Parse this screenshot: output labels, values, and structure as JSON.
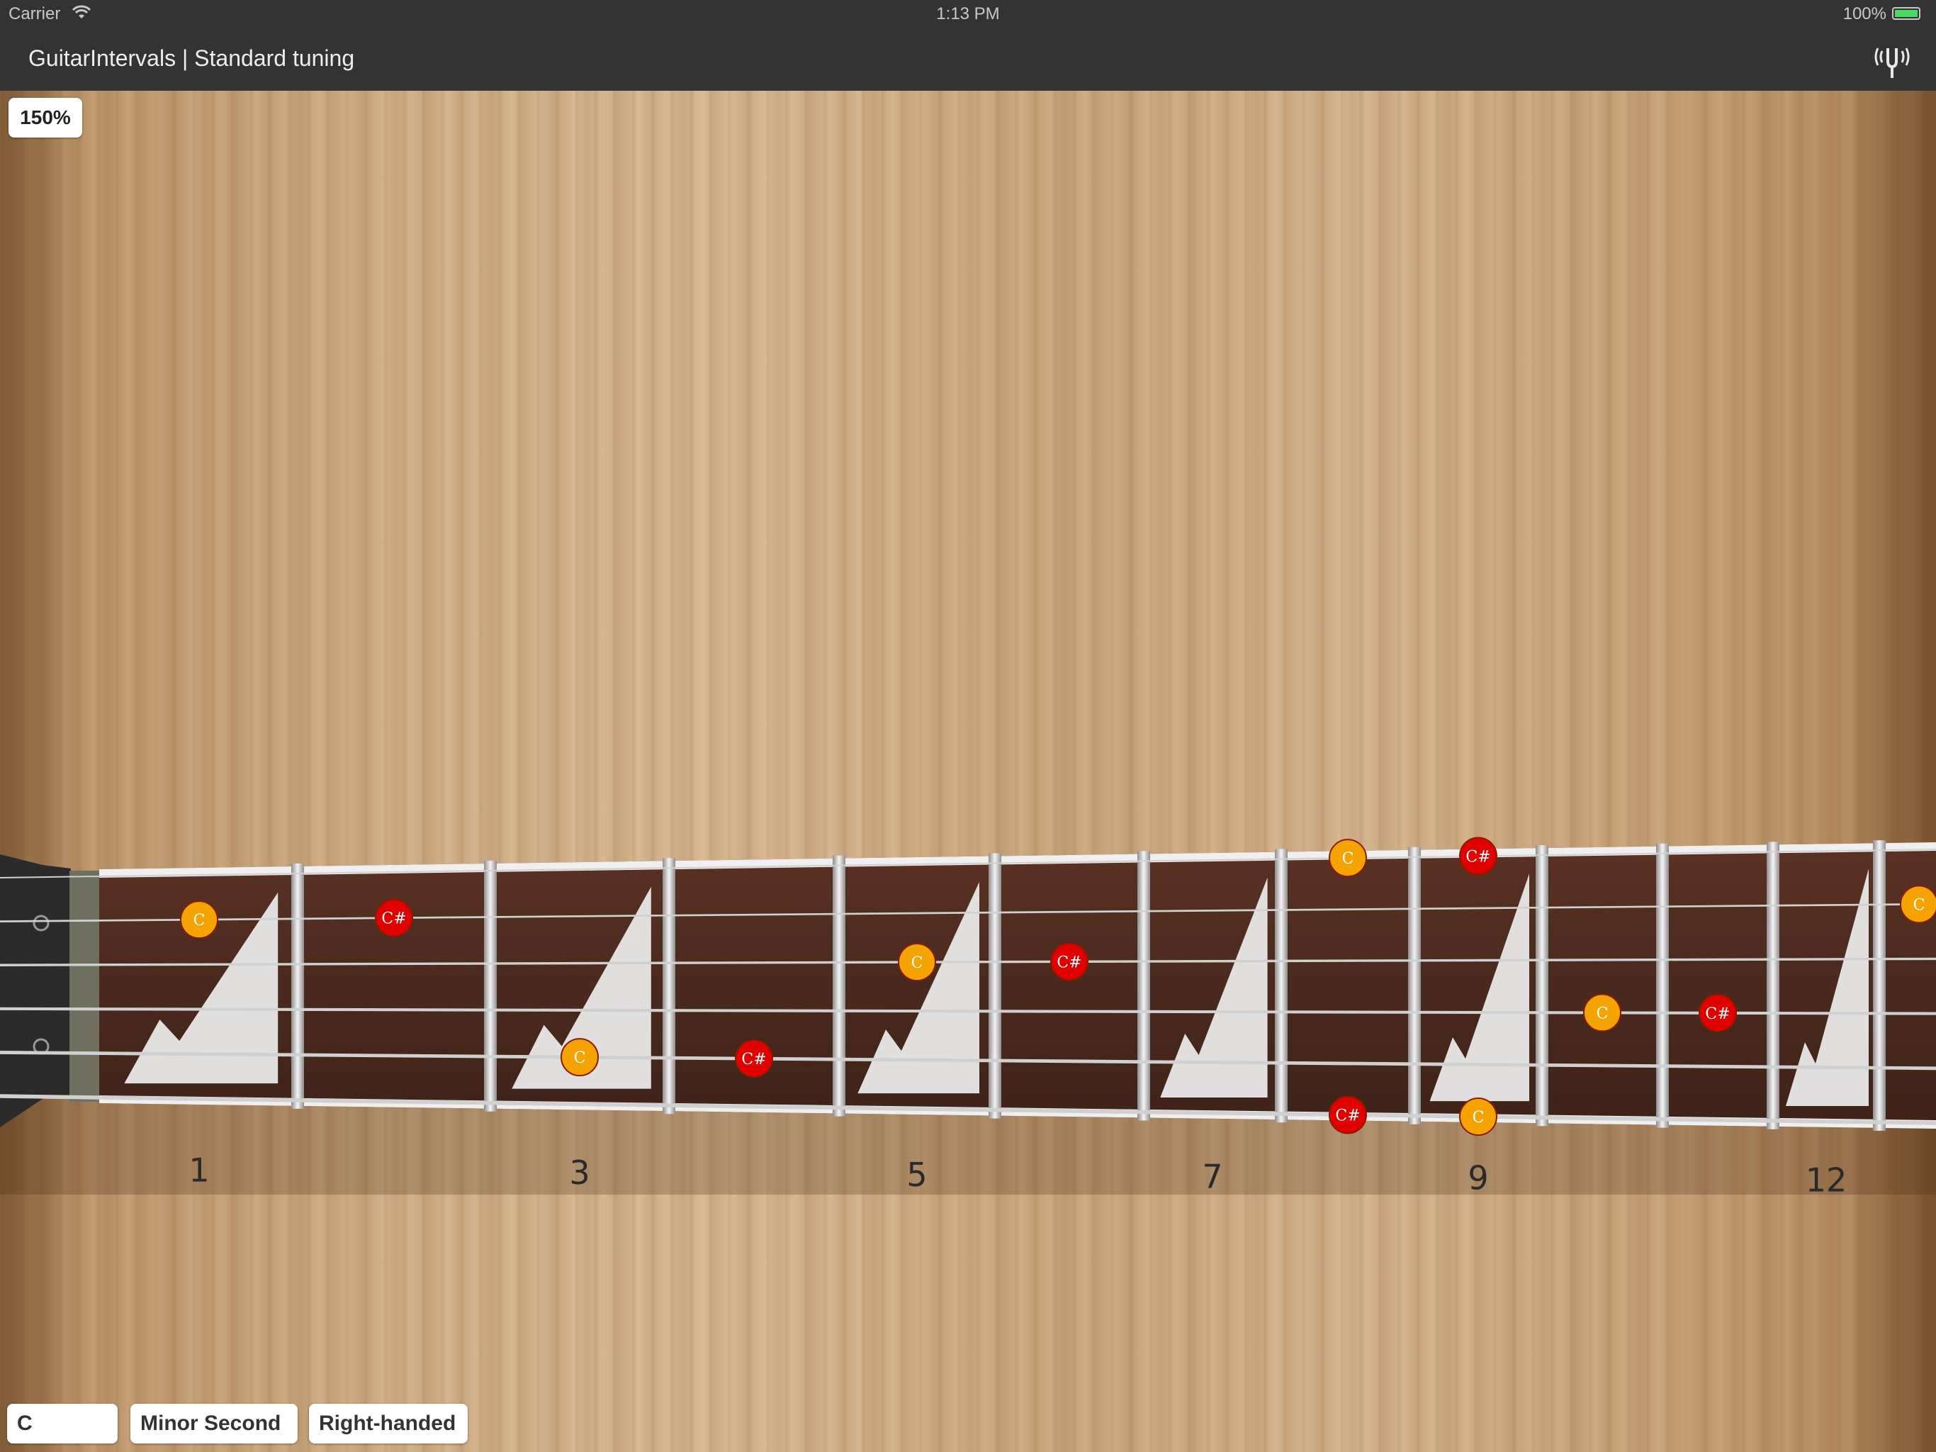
{
  "status_bar": {
    "carrier": "Carrier",
    "time": "1:13 PM",
    "battery": "100%",
    "battery_level": 1.0
  },
  "nav": {
    "title": "GuitarIntervals | Standard tuning",
    "tuner_icon": "tuning-fork-icon"
  },
  "zoom": {
    "label": "150%"
  },
  "fret_numbers": [
    "1",
    "3",
    "5",
    "7",
    "9",
    "12"
  ],
  "notes": [
    {
      "label": "C",
      "kind": "root"
    },
    {
      "label": "C#",
      "kind": "interval"
    },
    {
      "label": "C",
      "kind": "root"
    },
    {
      "label": "C#",
      "kind": "interval"
    },
    {
      "label": "C",
      "kind": "root"
    },
    {
      "label": "C#",
      "kind": "interval"
    },
    {
      "label": "C",
      "kind": "root"
    },
    {
      "label": "C#",
      "kind": "interval"
    },
    {
      "label": "C",
      "kind": "root"
    },
    {
      "label": "C#",
      "kind": "interval"
    },
    {
      "label": "C",
      "kind": "root"
    },
    {
      "label": "C#",
      "kind": "interval"
    },
    {
      "label": "C",
      "kind": "root"
    }
  ],
  "controls": {
    "root_note": "C",
    "interval": "Minor Second",
    "handedness": "Right-handed"
  },
  "colors": {
    "root": "#f5a300",
    "interval": "#e00000",
    "bar": "#333333",
    "fretboard": "#4a2a1e"
  }
}
